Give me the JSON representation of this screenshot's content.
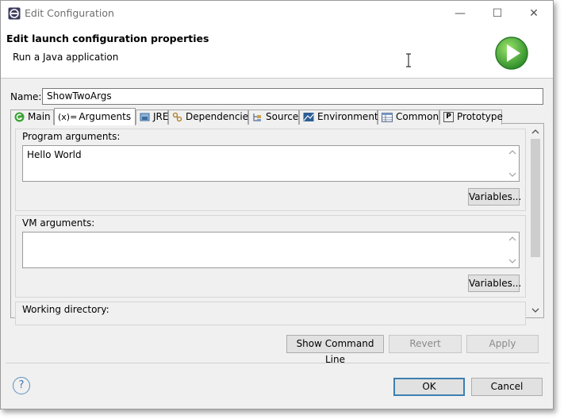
{
  "window": {
    "title": "Edit Configuration",
    "controls": {
      "minimize": "—",
      "maximize": "☐",
      "close": "✕"
    }
  },
  "banner": {
    "title": "Edit launch configuration properties",
    "subtitle": "Run a Java application"
  },
  "name_field": {
    "label": "Name:",
    "value": "ShowTwoArgs"
  },
  "tabs": [
    {
      "label": "Main",
      "icon": "main-icon",
      "active": false
    },
    {
      "label": "Arguments",
      "icon": "arguments-icon",
      "icon_text": "(x)=",
      "active": true
    },
    {
      "label": "JRE",
      "icon": "jre-icon",
      "active": false
    },
    {
      "label": "Dependencies",
      "icon": "dependencies-icon",
      "active": false
    },
    {
      "label": "Source",
      "icon": "source-icon",
      "active": false
    },
    {
      "label": "Environment",
      "icon": "environment-icon",
      "active": false
    },
    {
      "label": "Common",
      "icon": "common-icon",
      "active": false
    },
    {
      "label": "Prototype",
      "icon": "prototype-icon",
      "icon_text": "P",
      "active": false
    }
  ],
  "program_arguments": {
    "label": "Program arguments:",
    "value": "Hello World",
    "variables_label": "Variables..."
  },
  "vm_arguments": {
    "label": "VM arguments:",
    "value": "",
    "variables_label": "Variables..."
  },
  "working_directory": {
    "label": "Working directory:"
  },
  "actions": {
    "show_command_line": "Show Command Line",
    "revert": "Revert",
    "apply": "Apply"
  },
  "footer": {
    "ok": "OK",
    "cancel": "Cancel",
    "help_icon": "?"
  },
  "colors": {
    "run_green": "#3aa335",
    "accent": "#3c7fb1"
  }
}
